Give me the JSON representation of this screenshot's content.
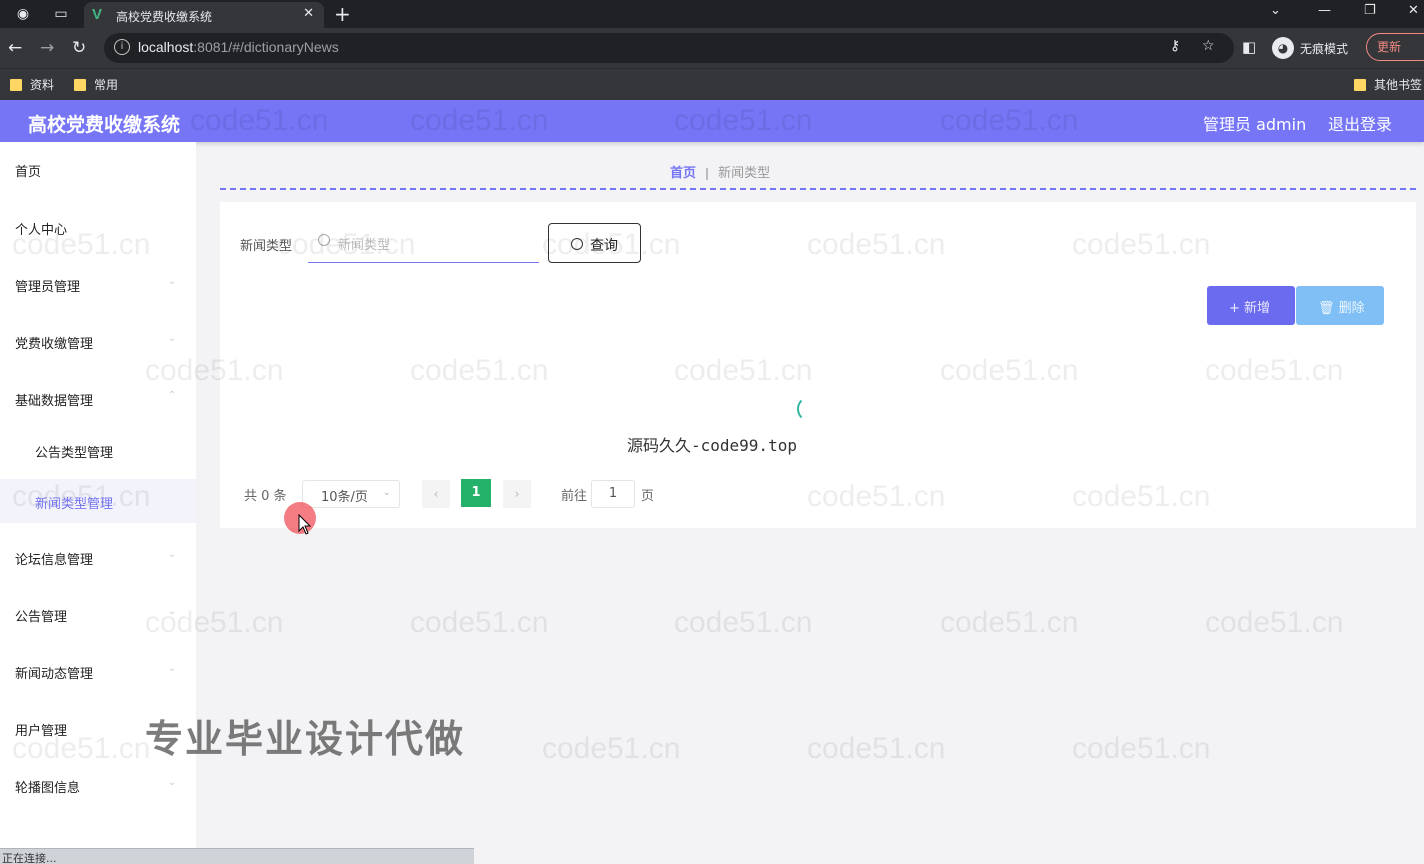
{
  "browser": {
    "tab_title": "高校党费收缴系统",
    "url_host": "localhost",
    "url_rest": ":8081/#/dictionaryNews",
    "incognito_label": "无痕模式",
    "update_label": "更新",
    "bookmarks": [
      "资料",
      "常用"
    ],
    "other_bookmarks": "其他书签"
  },
  "header": {
    "title": "高校党费收缴系统",
    "user": "管理员 admin",
    "logout": "退出登录",
    "accent_color": "#7575f6"
  },
  "sidebar": {
    "items": [
      {
        "label": "首页"
      },
      {
        "label": "个人中心"
      },
      {
        "label": "管理员管理"
      },
      {
        "label": "党费收缴管理"
      },
      {
        "label": "基础数据管理"
      },
      {
        "label": "公告类型管理"
      },
      {
        "label": "新闻类型管理"
      },
      {
        "label": "论坛信息管理"
      },
      {
        "label": "公告管理"
      },
      {
        "label": "新闻动态管理"
      },
      {
        "label": "用户管理"
      },
      {
        "label": "轮播图信息"
      }
    ]
  },
  "breadcrumb": {
    "home": "首页",
    "current": "新闻类型"
  },
  "search": {
    "label": "新闻类型",
    "placeholder": "新闻类型",
    "button": "查询"
  },
  "actions": {
    "add": "+ 新增",
    "delete": "删除"
  },
  "loading": {
    "text": "源码久久-code99.top"
  },
  "pagination": {
    "total": "共 0 条",
    "page_size": "10条/页",
    "current_page": "1",
    "goto_label": "前往",
    "goto_value": "1",
    "page_suffix": "页"
  },
  "overlay": {
    "watermark": "code51.cn",
    "ad": "专业毕业设计代做"
  },
  "status": {
    "text": "正在连接..."
  }
}
